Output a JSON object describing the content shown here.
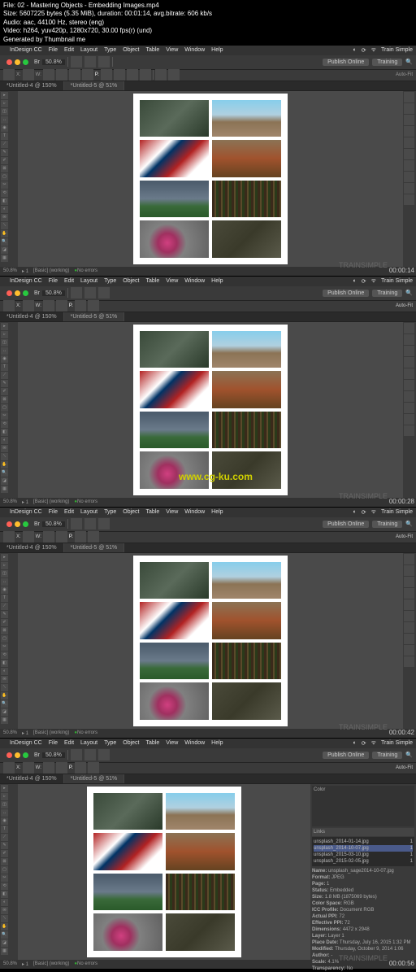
{
  "meta": {
    "file": "File: 02 - Mastering Objects - Embedding Images.mp4",
    "size": "Size: 5607225 bytes (5.35 MiB), duration: 00:01:14, avg.bitrate: 606 kb/s",
    "audio": "Audio: aac, 44100 Hz, stereo (eng)",
    "video": "Video: h264, yuv420p, 1280x720, 30.00 fps(r) (und)",
    "gen": "Generated by Thumbnail me"
  },
  "app": {
    "name": "InDesign CC",
    "menus": [
      "File",
      "Edit",
      "Layout",
      "Type",
      "Object",
      "Table",
      "View",
      "Window",
      "Help"
    ],
    "publish": "Publish Online",
    "training": "Training",
    "right_label": "Train Simple"
  },
  "toolbar": {
    "zoom": "50.8%",
    "tabs": [
      "*Untitled-4 @ 150%",
      "*Untitled-5 @ 51%"
    ],
    "autofit": "Auto-Fit"
  },
  "status": {
    "errors": "No errors",
    "basic": "[Basic] (working)"
  },
  "timestamps": [
    "00:00:14",
    "00:00:28",
    "00:00:42",
    "00:00:56"
  ],
  "watermark": "www.cg-ku.com",
  "brand": "TRAINSIMPLE",
  "links_panel": {
    "title": "Links",
    "color_title": "Color",
    "items": [
      {
        "name": "unsplash_2014-01-14.jpg",
        "n": "1"
      },
      {
        "name": "unsplash_2014-10-07.jpg",
        "n": "1",
        "sel": true
      },
      {
        "name": "unsplash_2015-03-10.jpg",
        "n": "1"
      },
      {
        "name": "unsplash_2015-02-05.jpg",
        "n": "1"
      }
    ],
    "info": {
      "name_l": "Name:",
      "name": "unsplash_sage2014-10-07.jpg",
      "format_l": "Format:",
      "format": "JPEG",
      "page_l": "Page:",
      "page": "1",
      "status_l": "Status:",
      "status": "Embedded",
      "size_l": "Size:",
      "size": "1.8 MB (1875069 bytes)",
      "cs_l": "Color Space:",
      "cs": "RGB",
      "icc_l": "ICC Profile:",
      "icc": "Document RGB",
      "act_l": "Actual PPI:",
      "act": "72",
      "eff_l": "Effective PPI:",
      "eff": "72",
      "dim_l": "Dimensions:",
      "dim": "4472 x 2948",
      "layer_l": "Layer:",
      "layer": "Layer 1",
      "place_l": "Place Date:",
      "place": "Thursday, July 16, 2015 1:32 PM",
      "mod_l": "Modified:",
      "mod": "Thursday, October 9, 2014 1:06",
      "author_l": "Author:",
      "author": "-",
      "scale_l": "Scale:",
      "scale": "4.1%",
      "trans_l": "Transparency:",
      "trans": "No"
    }
  }
}
